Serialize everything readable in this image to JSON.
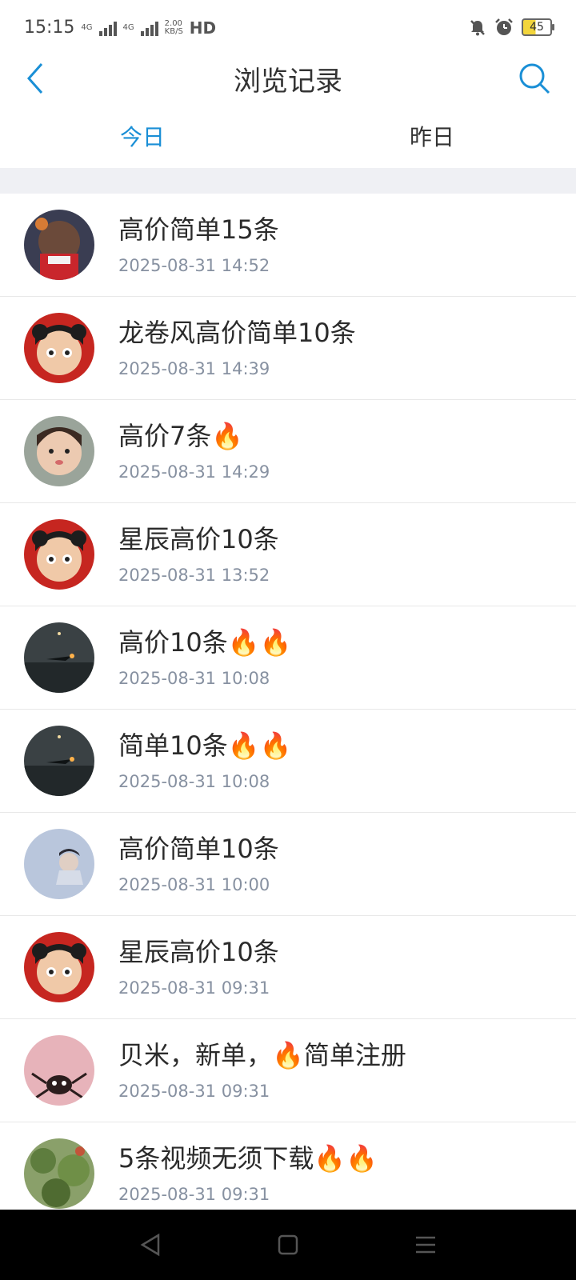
{
  "status_bar": {
    "time": "15:15",
    "net1": "4G",
    "net2": "4G",
    "speed_top": "2.00",
    "speed_bottom": "KB/S",
    "hd": "HD",
    "battery": "45"
  },
  "header": {
    "title": "浏览记录"
  },
  "tabs": {
    "today": "今日",
    "yesterday": "昨日"
  },
  "items": [
    {
      "title": "高价简单15条",
      "time": "2025-08-31 14:52"
    },
    {
      "title": "龙卷风高价简单10条",
      "time": "2025-08-31 14:39"
    },
    {
      "title": "高价7条🔥",
      "time": "2025-08-31 14:29"
    },
    {
      "title": "星辰高价10条",
      "time": "2025-08-31 13:52"
    },
    {
      "title": "高价10条🔥🔥",
      "time": "2025-08-31 10:08"
    },
    {
      "title": "简单10条🔥🔥",
      "time": "2025-08-31 10:08"
    },
    {
      "title": "高价简单10条",
      "time": "2025-08-31 10:00"
    },
    {
      "title": "星辰高价10条",
      "time": "2025-08-31 09:31"
    },
    {
      "title": "贝米，新单，🔥简单注册",
      "time": "2025-08-31 09:31"
    },
    {
      "title": "5条视频无须下载🔥🔥",
      "time": "2025-08-31 09:31"
    }
  ],
  "colors": {
    "accent": "#1a8fd6",
    "time_text": "#8791a1",
    "band": "#eff0f4"
  }
}
